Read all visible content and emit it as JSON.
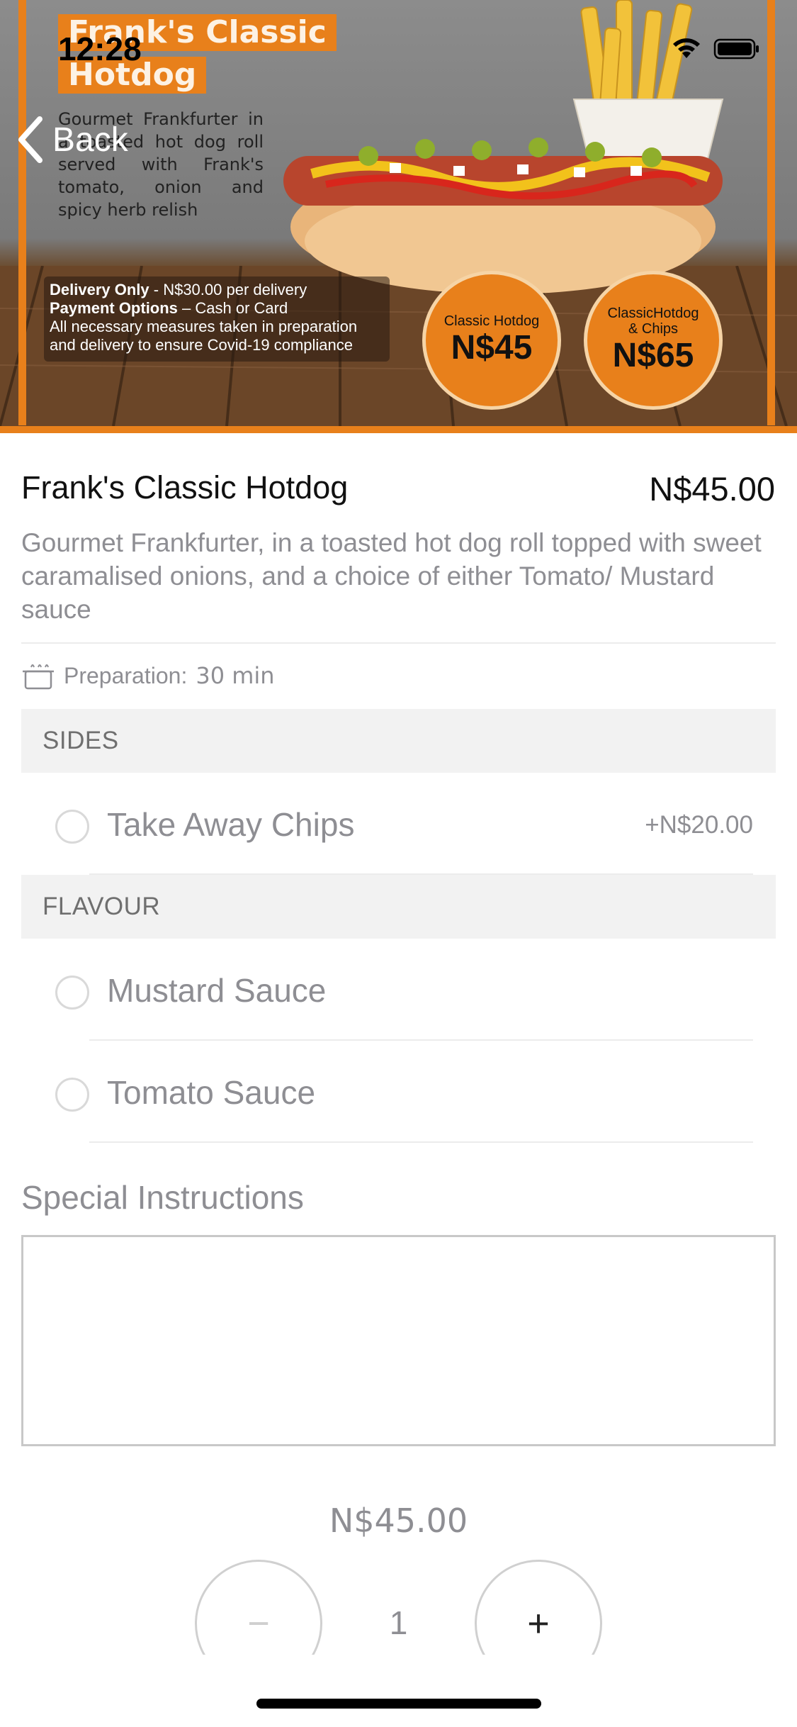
{
  "status_bar": {
    "time": "12:28"
  },
  "nav": {
    "back_label": "Back"
  },
  "hero": {
    "title_line1": "Frank's Classic",
    "title_line2": "Hotdog",
    "description": "Gourmet Frankfurter in a toasted hot dog roll served with Frank's tomato, onion and spicy herb relish",
    "delivery_bold": "Delivery Only",
    "delivery_text": " - N$30.00 per delivery",
    "payment_bold": "Payment Options",
    "payment_text": " – Cash or Card",
    "covid_note": "All necessary measures taken in preparation and delivery to ensure Covid-19 compliance",
    "badges": [
      {
        "label": "Classic Hotdog",
        "price": "N$45"
      },
      {
        "label": "ClassicHotdog & Chips",
        "price": "N$65"
      }
    ],
    "accent_color": "#e8801b"
  },
  "item": {
    "title": "Frank's Classic Hotdog",
    "price": "N$45.00",
    "description": "Gourmet Frankfurter, in a toasted hot dog roll topped with sweet caramalised onions, and a choice of either Tomato/ Mustard sauce"
  },
  "preparation": {
    "label": "Preparation:",
    "value": "30 min",
    "icon": "cooking-pot-icon"
  },
  "sections": [
    {
      "title": "SIDES",
      "options": [
        {
          "label": "Take Away Chips",
          "price": "+N$20.00",
          "selected": false
        }
      ]
    },
    {
      "title": "FLAVOUR",
      "options": [
        {
          "label": "Mustard Sauce",
          "selected": false
        },
        {
          "label": "Tomato Sauce",
          "selected": false
        }
      ]
    }
  ],
  "instructions": {
    "label": "Special Instructions",
    "value": ""
  },
  "order": {
    "total": "N$45.00",
    "quantity": "1",
    "minus_symbol": "−",
    "plus_symbol": "+"
  }
}
